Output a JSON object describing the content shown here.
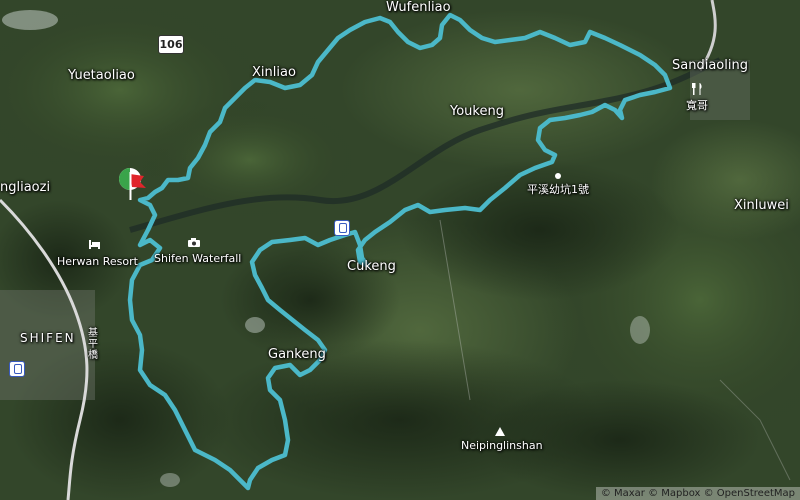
{
  "map": {
    "road_shield": "106",
    "labels": {
      "wufenliao": "Wufenliao",
      "sandiaoling": "Sandiaoling",
      "yuetaoliao": "Yuetaoliao",
      "xinliao": "Xinliao",
      "youkeng": "Youkeng",
      "xinluwei": "Xinluwei",
      "gliaozi": "ngliaozi",
      "herwan": "Herwan Resort",
      "shifen_waterfall": "Shifen Waterfall",
      "cukeng": "Cukeng",
      "shifen": "SHIFEN",
      "gankeng": "Gankeng",
      "neipinglinshan": "Neipinglinshan",
      "school": "平溪幼坑1號",
      "restaurant": "寬哥",
      "road_vertical": "基平橋"
    },
    "icons": [
      "start-flag-icon",
      "train-station-icon",
      "camera-icon",
      "hotel-icon",
      "restaurant-icon",
      "peak-icon",
      "school-icon"
    ],
    "route_color": "#4bb8c8",
    "attribution": "© Maxar © Mapbox © OpenStreetMap"
  }
}
